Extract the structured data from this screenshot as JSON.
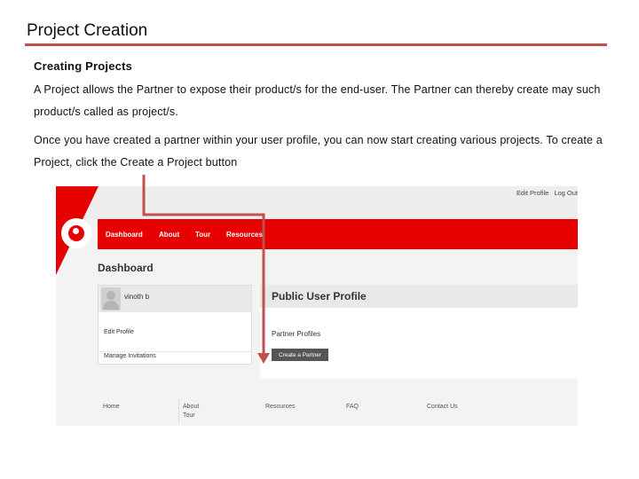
{
  "slide": {
    "title": "Project Creation",
    "heading": "Creating Projects",
    "para1": "A Project allows the Partner to expose their product/s for the end-user. The Partner can thereby create may such product/s called as project/s.",
    "para2": "Once you have created a partner within your user profile, you can now start creating various projects. To create a Project, click the Create a Project button"
  },
  "colors": {
    "title_rule": "#c0504d",
    "brand_red": "#e60000",
    "arrow": "#c0504d"
  },
  "screenshot": {
    "top_links": [
      "Edit Profile",
      "Log Out"
    ],
    "nav": [
      "Dashboard",
      "About",
      "Tour",
      "Resources"
    ],
    "page_title": "Dashboard",
    "user_name": "vinoth b",
    "side_links": [
      "Edit Profile",
      "Manage Invitations"
    ],
    "profile_title": "Public User Profile",
    "partner_profiles_label": "Partner Profiles",
    "create_partner_label": "Create a Partner",
    "footer": [
      "Home",
      "About",
      "Tour",
      "Resources",
      "FAQ",
      "Contact Us"
    ],
    "logo_icon": "vodafone-logo-icon"
  }
}
